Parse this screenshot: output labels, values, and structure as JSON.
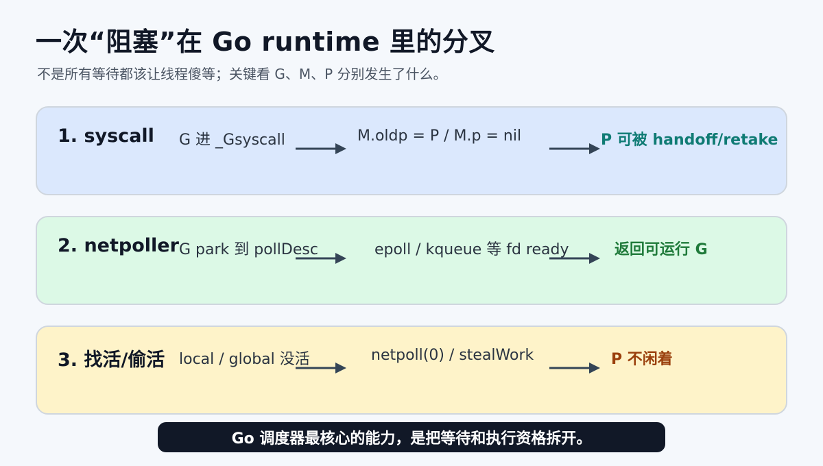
{
  "title": "一次“阻塞”在 Go runtime 里的分叉",
  "subtitle": "不是所有等待都该让线程傻等；关键看 G、M、P 分别发生了什么。",
  "colors": {
    "row1_bg": "#dbe8fd",
    "row2_bg": "#dcf9e6",
    "row3_bg": "#fef3c9",
    "arrow": "#344456",
    "result1": "#0f7b74",
    "result2": "#1f7a3a",
    "result3": "#9a3f0c"
  },
  "rows": [
    {
      "title": "1. syscall",
      "step1": "G 进 _Gsyscall",
      "step2": "M.oldp = P / M.p = nil",
      "result": "P 可被 handoff/retake"
    },
    {
      "title": "2. netpoller",
      "step1": "G park 到 pollDesc",
      "step2": "epoll / kqueue 等 fd ready",
      "result": "返回可运行 G"
    },
    {
      "title": "3. 找活/偷活",
      "step1": "local / global 没活",
      "step2": "netpoll(0) / stealWork",
      "result": "P 不闲着"
    }
  ],
  "banner": "Go 调度器最核心的能力，是把等待和执行资格拆开。"
}
